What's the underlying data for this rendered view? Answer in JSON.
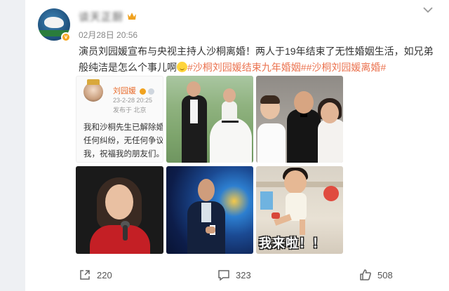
{
  "post": {
    "username": "谈天正厨",
    "timestamp": "02月28日 20:56",
    "text_main": "演员刘园媛宣布与央视主持人沙桐离婚！两人于19年结束了无性婚姻生活，如兄弟般纯洁是怎么个事儿啊",
    "hashtag_1": "#沙桐刘园媛结束九年婚姻#",
    "hashtag_2": "#沙桐刘园媛离婚#",
    "avatar_badge": "v"
  },
  "images": {
    "screenshot": {
      "name": "刘园媛",
      "datetime": "23-2-28 20:25",
      "location": "发布于 北京",
      "line1": "我和沙桐先生已解除婚",
      "line2": "任何纠纷，无任何争议",
      "line3": "我，祝福我的朋友们。"
    },
    "meme_caption": "我来啦！！"
  },
  "actions": {
    "share_count": "220",
    "comment_count": "323",
    "like_count": "508"
  },
  "colors": {
    "accent_orange": "#eb7350",
    "text": "#333333",
    "muted": "#888888"
  }
}
